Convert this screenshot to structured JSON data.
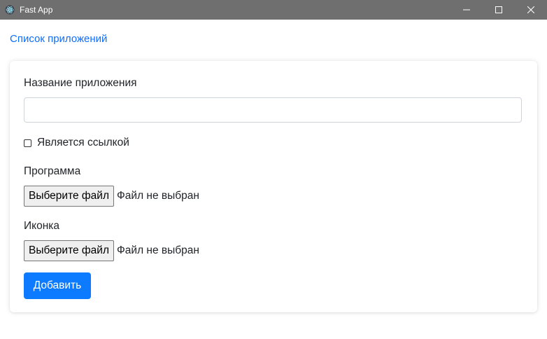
{
  "window": {
    "title": "Fast App",
    "controls": {
      "minimize": "—",
      "maximize": "☐",
      "close": "✕"
    }
  },
  "nav": {
    "apps_list_link": "Список приложений"
  },
  "form": {
    "app_name_label": "Название приложения",
    "app_name_value": "",
    "is_link_label": "Является ссылкой",
    "is_link_checked": false,
    "program_label": "Программа",
    "program_button": "Выберите файл",
    "program_status": "Файл не выбран",
    "icon_label": "Иконка",
    "icon_button": "Выберите файл",
    "icon_status": "Файл не выбран",
    "submit_label": "Добавить"
  },
  "colors": {
    "titlebar": "#6f6f6f",
    "link": "#0d6efd",
    "primary_button": "#0d7bff"
  },
  "icons": {
    "app": "electron-icon"
  }
}
